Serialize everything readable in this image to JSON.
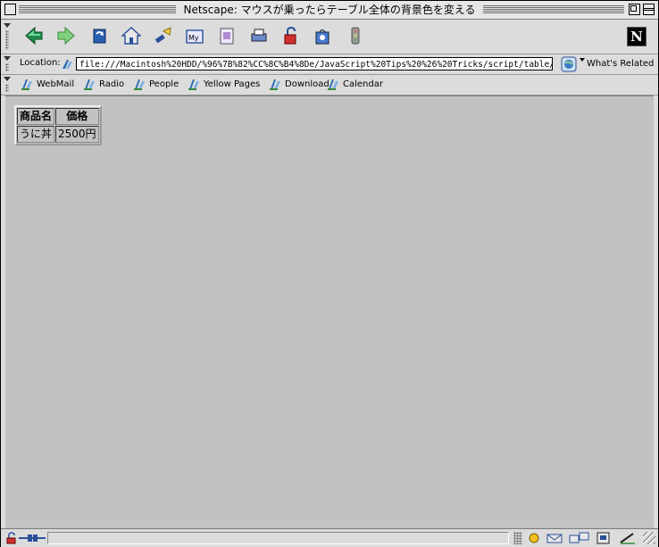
{
  "window": {
    "title": "Netscape: マウスが乗ったらテーブル全体の背景色を変える"
  },
  "navigation_toolbar": {
    "buttons": [
      {
        "name": "back"
      },
      {
        "name": "forward"
      },
      {
        "name": "reload"
      },
      {
        "name": "home"
      },
      {
        "name": "search"
      },
      {
        "name": "my-netscape"
      },
      {
        "name": "images"
      },
      {
        "name": "print"
      },
      {
        "name": "security"
      },
      {
        "name": "shop"
      },
      {
        "name": "stop"
      }
    ],
    "logo_letter": "N"
  },
  "location_toolbar": {
    "label": "Location:",
    "url": "file:///Macintosh%20HDD/%96%7B%82%CC%8C%B4%8De/JavaScript%20Tips%20%26%20Tricks/script/table/",
    "related_label": "What's Related"
  },
  "personal_toolbar": {
    "items": [
      {
        "label": "WebMail"
      },
      {
        "label": "Radio"
      },
      {
        "label": "People"
      },
      {
        "label": "Yellow Pages"
      },
      {
        "label": "Download"
      },
      {
        "label": "Calendar"
      }
    ]
  },
  "page": {
    "table": {
      "headers": [
        "商品名",
        "価格"
      ],
      "rows": [
        [
          "うに丼",
          "2500円"
        ]
      ]
    }
  },
  "status_bar": {
    "text": ""
  },
  "colors": {
    "chrome": "#dcdcdc",
    "content_bg": "#c2c2c2",
    "title_bg": "#e6e6e6"
  }
}
